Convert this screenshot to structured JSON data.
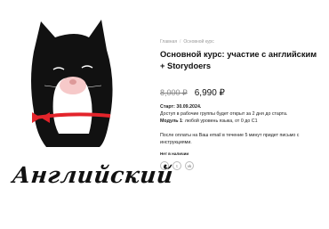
{
  "brand_word": "Английский",
  "breadcrumb": {
    "home": "Главная",
    "separator": "/",
    "current": "Основной курс"
  },
  "product": {
    "title": "Основной курс: участие с английским + Storydoers",
    "price_old": "8,000 ₽",
    "price_new": "6,990 ₽",
    "start_label": "Старт:",
    "start_date": "30.09.2024.",
    "access_text": "Доступ в рабочие группы будет открыт за 2 дня до старта.",
    "module_label": "Модуль 1",
    "module_text": ": любой уровень языка, от 0 до С1",
    "after_payment": "После оплаты на Ваш email в течение 5 минут придет письмо с инструкциями.",
    "stock": "Нет в наличии"
  },
  "share": [
    {
      "icon": "facebook-icon",
      "glyph": "f"
    },
    {
      "icon": "twitter-icon",
      "glyph": "t"
    },
    {
      "icon": "vk-icon",
      "glyph": "vk"
    }
  ],
  "colors": {
    "cat": "#111111",
    "ribbon": "#e3242b",
    "muzzle": "#f6c9c9"
  }
}
